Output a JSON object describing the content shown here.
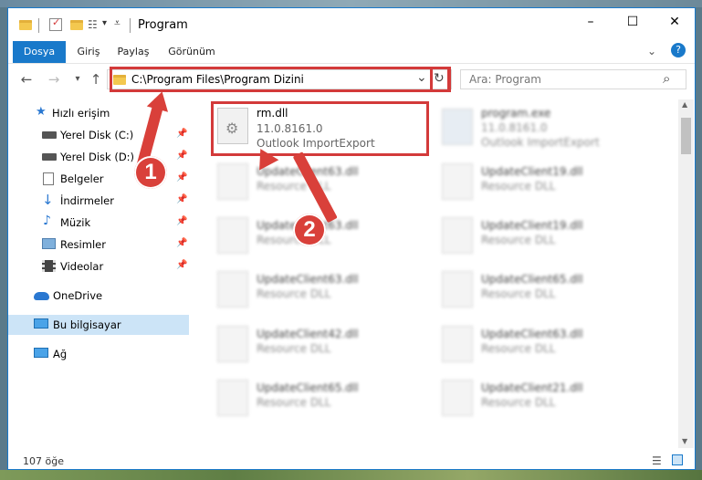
{
  "window": {
    "title": "Program",
    "controls": {
      "minimize": "–",
      "maximize": "☐",
      "close": "✕"
    }
  },
  "ribbon": {
    "tabs": [
      {
        "label": "Dosya",
        "active": true
      },
      {
        "label": "Giriş"
      },
      {
        "label": "Paylaş"
      },
      {
        "label": "Görünüm"
      }
    ],
    "help": "?"
  },
  "nav": {
    "back": "←",
    "forward": "→",
    "recent": "▾",
    "up": "↑",
    "address": "C:\\Program Files\\Program Dizini",
    "address_dropdown": "⌄",
    "refresh": "↻",
    "search_placeholder": "Ara: Program",
    "search_icon": "⌕"
  },
  "sidebar": {
    "items": [
      {
        "label": "Hızlı erişim",
        "icon": "star-icon",
        "pinned": false
      },
      {
        "label": "Yerel Disk (C:)",
        "icon": "drive-icon",
        "pinned": true
      },
      {
        "label": "Yerel Disk (D:)",
        "icon": "drive-icon",
        "pinned": true
      },
      {
        "label": "Belgeler",
        "icon": "documents-icon",
        "pinned": true
      },
      {
        "label": "İndirmeler",
        "icon": "download-icon",
        "pinned": true
      },
      {
        "label": "Müzik",
        "icon": "music-icon",
        "pinned": true
      },
      {
        "label": "Resimler",
        "icon": "pictures-icon",
        "pinned": true
      },
      {
        "label": "Videolar",
        "icon": "video-icon",
        "pinned": true
      },
      {
        "label": "OneDrive",
        "icon": "cloud-icon"
      },
      {
        "label": "Bu bilgisayar",
        "icon": "computer-icon",
        "selected": true
      },
      {
        "label": "Ağ",
        "icon": "network-icon"
      }
    ],
    "pin_glyph": "📌"
  },
  "files": {
    "highlighted": {
      "name": "rm.dll",
      "version": "11.0.8161.0",
      "description": "Outlook ImportExport"
    },
    "col1": [
      {
        "name": "UpdateClient63.dll",
        "type": "Resource DLL"
      },
      {
        "name": "UpdateClient63.dll",
        "type": "Resource DLL"
      },
      {
        "name": "UpdateClient63.dll",
        "type": "Resource DLL"
      },
      {
        "name": "UpdateClient42.dll",
        "type": "Resource DLL"
      },
      {
        "name": "UpdateClient65.dll",
        "type": "Resource DLL"
      }
    ],
    "col2": [
      {
        "name": "program.exe",
        "type": "11.0.8161.0",
        "extra": "Outlook ImportExport"
      },
      {
        "name": "UpdateClient19.dll",
        "type": "Resource DLL"
      },
      {
        "name": "UpdateClient19.dll",
        "type": "Resource DLL"
      },
      {
        "name": "UpdateClient65.dll",
        "type": "Resource DLL"
      },
      {
        "name": "UpdateClient63.dll",
        "type": "Resource DLL"
      },
      {
        "name": "UpdateClient21.dll",
        "type": "Resource DLL"
      }
    ]
  },
  "annotations": {
    "step1": "1",
    "step2": "2"
  },
  "status": {
    "item_count": "107 öğe"
  },
  "colors": {
    "accent": "#1979ca",
    "highlight": "#d33a3a",
    "selected": "#cce4f7"
  }
}
